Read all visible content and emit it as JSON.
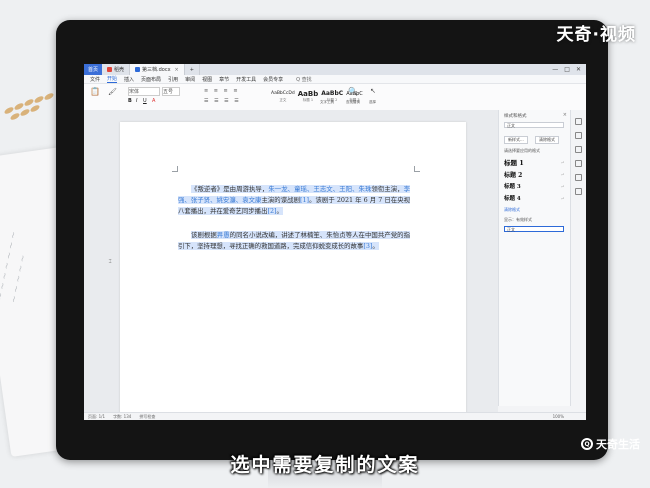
{
  "watermark": {
    "brand": "天奇·视频"
  },
  "corner_logo": {
    "label": "天奇生活",
    "badge": "Q"
  },
  "subtitle": "选中需要复制的文案",
  "app": {
    "home_tab": "首页",
    "tabs": [
      {
        "label": "稻壳",
        "color": "#e0453a"
      },
      {
        "label": "第三档.docx",
        "color": "#2d6ad8"
      }
    ],
    "window_controls": [
      "—",
      "□",
      "✕"
    ]
  },
  "menu": {
    "items": [
      "文件",
      "开始",
      "插入",
      "页面布局",
      "引用",
      "审阅",
      "视图",
      "章节",
      "开发工具",
      "会员专享"
    ],
    "active_index": 1,
    "search": "Q 查找"
  },
  "ribbon": {
    "font_name": "宋体",
    "font_size": "五号",
    "styles": [
      {
        "sample": "AaBbCcDd",
        "name": "正文"
      },
      {
        "sample": "AaBb",
        "name": "标题 1"
      },
      {
        "sample": "AaBbC",
        "name": "标题 2"
      },
      {
        "sample": "AaBbC",
        "name": "标题 3"
      }
    ],
    "find_replace": "查找替换",
    "select": "选择",
    "text_tools": "文字工具"
  },
  "document": {
    "para1": {
      "intro": "《叛逆者》是由周游执导，",
      "cast": "朱一龙、童瑶、王志文、王阳、朱珠",
      "middle": "领衔主演，",
      "cast2": "李强、张子贤、姚安濂、袁文康",
      "tail": "主演的谍战剧",
      "ref1": "[1]",
      "air": "。该剧于 2021 年 6 月 7 日在央视八套播出，并在爱奇艺同步播出",
      "ref2": "[2]",
      "end": "。"
    },
    "para2": {
      "start": "该剧根据",
      "author": "畀愚",
      "rest": "的同名小说改编，讲述了林楠笙、朱怡贞等人在中国共产党的指引下，坚持理想，寻找正确的救国道路，完成信仰蜕变成长的故事",
      "ref": "[3]",
      "end": "。"
    }
  },
  "right_pane": {
    "title": "样式和格式",
    "current_style": "正文",
    "new_style_btn": "新样式...",
    "clear_btn": "清除格式",
    "section_label": "请选择要应用的格式",
    "headings": [
      "标题 1",
      "标题 2",
      "标题 3",
      "标题 4"
    ],
    "link_label": "清除格式",
    "show_label": "显示：有效样式",
    "preview_label": "正文"
  },
  "statusbar": {
    "page": "页面: 1/1",
    "words": "字数: 134",
    "check": "拼写检查",
    "zoom": "100%"
  }
}
